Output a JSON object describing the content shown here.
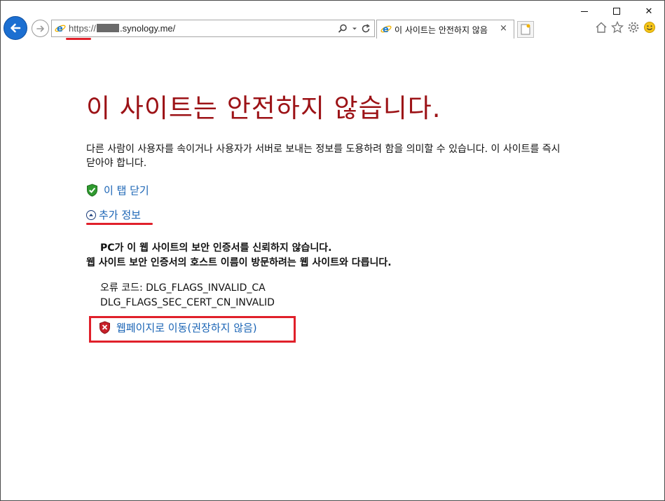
{
  "browser": {
    "address_bar": {
      "url_scheme": "https://",
      "url_host_suffix": ".synology.me/"
    },
    "tab": {
      "title": "이 사이트는 안전하지 않음",
      "close_glyph": "×"
    },
    "window_controls": {
      "close_glyph": "✕"
    }
  },
  "page": {
    "headline": "이 사이트는 안전하지 않습니다.",
    "description": "다른 사람이 사용자를 속이거나 사용자가 서버로 보내는 정보를 도용하려 함을 의미할 수 있습니다. 이 사이트를 즉시 닫아야 합니다.",
    "close_tab_link": "이 탭 닫기",
    "more_info_link": "추가 정보",
    "details": {
      "line1": "PC가 이 웹 사이트의 보안 인증서를 신뢰하지 않습니다.",
      "line2": "웹 사이트 보안 인증서의 호스트 이름이 방문하려는 웹 사이트와 다릅니다."
    },
    "error": {
      "label": "오류 코드: DLG_FLAGS_INVALID_CA",
      "code2": "DLG_FLAGS_SEC_CERT_CN_INVALID"
    },
    "proceed_link": "웹페이지로 이동(권장하지 않음)"
  },
  "colors": {
    "headline": "#9c1216",
    "link": "#1a64b5",
    "highlight": "#e0202a",
    "back_button": "#1c6fd1"
  },
  "icons": {
    "back": "arrow-left-icon",
    "forward": "arrow-right-icon",
    "site": "ie-logo-icon",
    "search": "search-icon",
    "refresh": "refresh-icon",
    "home": "home-icon",
    "favorites": "star-icon",
    "tools": "gear-icon",
    "feedback": "smiley-icon",
    "close_tab": "green-shield-check-icon",
    "more_info": "chevron-up-circle-icon",
    "proceed": "red-shield-x-icon"
  }
}
